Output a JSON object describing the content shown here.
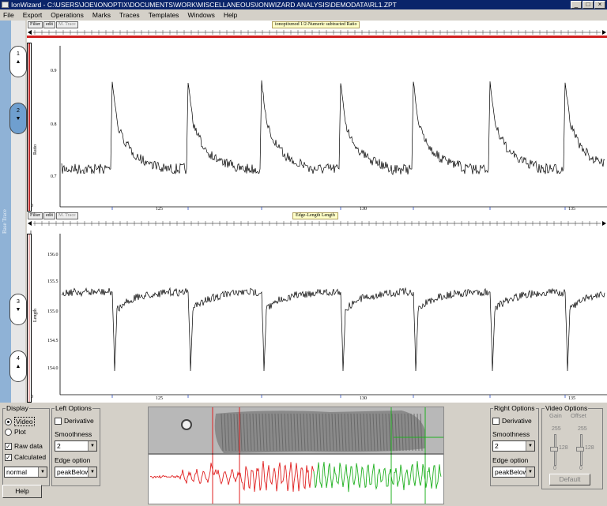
{
  "window": {
    "title": "IonWizard - C:\\USERS\\JOE\\IONOPTIX\\DOCUMENTS\\WORK\\MISCELLANEOUS\\IONWIZARD ANALYSIS\\DEMODATA\\RL1.ZPT",
    "btn_min": "_",
    "btn_max": "□",
    "btn_close": "×"
  },
  "menu": [
    "File",
    "Export",
    "Operations",
    "Marks",
    "Traces",
    "Templates",
    "Windows",
    "Help"
  ],
  "sidebar": {
    "label": "Base Trace"
  },
  "nav": [
    {
      "num": "1",
      "arrow": "▲"
    },
    {
      "num": "2",
      "arrow": "▼"
    },
    {
      "num": "3",
      "arrow": "▼"
    },
    {
      "num": "4",
      "arrow": "▲"
    }
  ],
  "panels": [
    {
      "filter_label": "Filter",
      "edit_label": "edit",
      "mtrace_label": "M. Trace",
      "trace_label": "ionoptixmod 1/2-Numeric subtracted Ratio",
      "ylabel": "Ratio",
      "yticks": [
        "0.9",
        "0.8",
        "0.7"
      ],
      "xticks": [
        "125",
        "130",
        "135"
      ],
      "zero_label": "0"
    },
    {
      "filter_label": "Filter",
      "edit_label": "edit",
      "mtrace_label": "M. Trace",
      "trace_label": "Edge-Length  Length",
      "ylabel": "Length",
      "yticks": [
        "156.0",
        "155.5",
        "155.0",
        "154.5",
        "154.0"
      ],
      "xticks": [
        "125",
        "130",
        "135"
      ],
      "zero_label": "0"
    }
  ],
  "display": {
    "title": "Display",
    "video_label": "Video",
    "plot_label": "Plot",
    "raw_label": "Raw data",
    "calc_label": "Calculated",
    "mode_value": "normal",
    "help_label": "Help"
  },
  "left_options": {
    "title": "Left Options",
    "derivative_label": "Derivative",
    "smoothness_label": "Smoothness",
    "smoothness_value": "2",
    "edge_label": "Edge option",
    "edge_value": "peakBelow"
  },
  "right_options": {
    "title": "Right Options",
    "derivative_label": "Derivative",
    "smoothness_label": "Smoothness",
    "smoothness_value": "2",
    "edge_label": "Edge option",
    "edge_value": "peakBelow"
  },
  "video_options": {
    "title": "Video Options",
    "gain_label": "Gain",
    "offset_label": "Offset",
    "gain_max": "255",
    "gain_value": "128",
    "gain_min": "0",
    "offset_max": "255",
    "offset_value": "128",
    "offset_min": "0",
    "default_label": "Default"
  },
  "colors": {
    "accent_blue": "#0a246a",
    "sidebar": "#8fb2d6",
    "edge_red": "#e02020",
    "edge_green": "#20b020"
  }
}
